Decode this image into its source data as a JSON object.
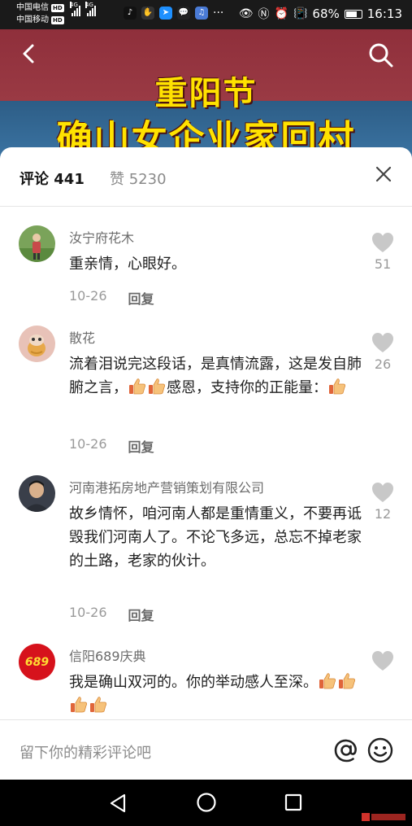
{
  "status_bar": {
    "carrier1": "中国电信",
    "carrier2": "中国移动",
    "hd_badge": "HD",
    "net_label": "4G",
    "battery": "68%",
    "battery_level": 0.68,
    "time": "16:13",
    "more": "···"
  },
  "video": {
    "title_line1": "重阳节",
    "title_line2": "确山女企业家回村"
  },
  "tabs": {
    "comments": "评论 441",
    "likes": "赞 5230"
  },
  "comments": [
    {
      "user": "汝宁府花木",
      "text": "重亲情，心眼好。",
      "date": "10-26",
      "reply": "回复",
      "likes": "51"
    },
    {
      "user": "散花",
      "text_before": "流着泪说完这段话，是真情流露，这是发自肺腑之言，",
      "text_middle": "感恩，支持你的正能量：",
      "date": "10-26",
      "reply": "回复",
      "likes": "26"
    },
    {
      "user": "河南港拓房地产营销策划有限公司",
      "text": "故乡情怀，咱河南人都是重情重义，不要再诋毁我们河南人了。不论飞多远，总忘不掉老家的土路，老家的伙计。",
      "date": "10-26",
      "reply": "回复",
      "likes": "12"
    },
    {
      "user": "信阳689庆典",
      "text": "我是确山双河的。你的举动感人至深。",
      "avatar_text": "689"
    }
  ],
  "input": {
    "placeholder": "留下你的精彩评论吧"
  },
  "colors": {
    "video_red": "#9a3a44",
    "video_blue": "#3b74a3",
    "title_yellow": "#ffe200"
  }
}
